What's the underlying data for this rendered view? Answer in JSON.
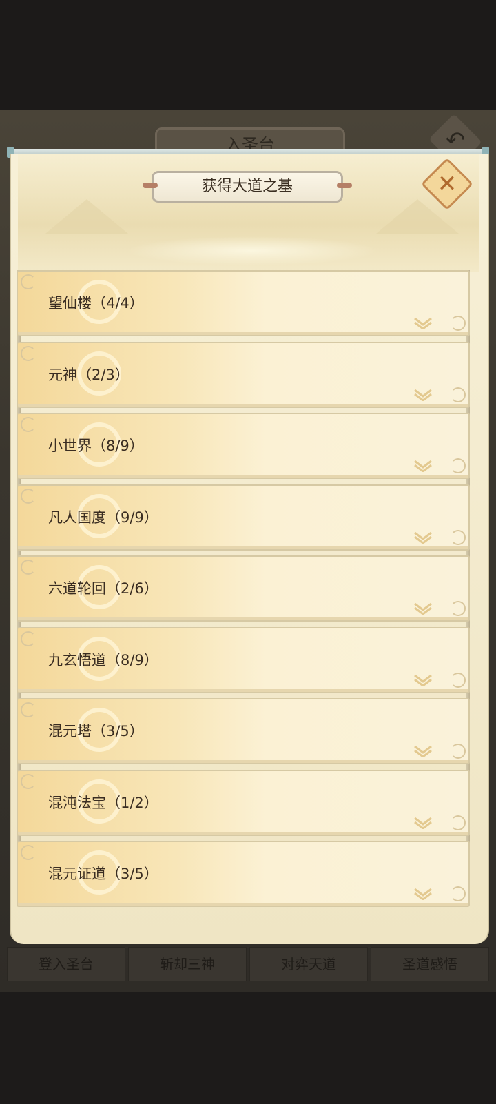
{
  "background": {
    "title": "入圣台",
    "tabs": [
      "登入圣台",
      "斩却三神",
      "对弈天道",
      "圣道感悟"
    ]
  },
  "dialog": {
    "title": "获得大道之基",
    "items": [
      {
        "label": "望仙楼（4/4）"
      },
      {
        "label": "元神（2/3）"
      },
      {
        "label": "小世界（8/9）"
      },
      {
        "label": "凡人国度（9/9）"
      },
      {
        "label": "六道轮回（2/6）"
      },
      {
        "label": "九玄悟道（8/9）"
      },
      {
        "label": "混元塔（3/5）"
      },
      {
        "label": "混沌法宝（1/2）"
      },
      {
        "label": "混元证道（3/5）"
      }
    ]
  },
  "colors": {
    "accent": "#c5894f",
    "panel": "#f7f0d7",
    "text": "#3a2d22"
  }
}
